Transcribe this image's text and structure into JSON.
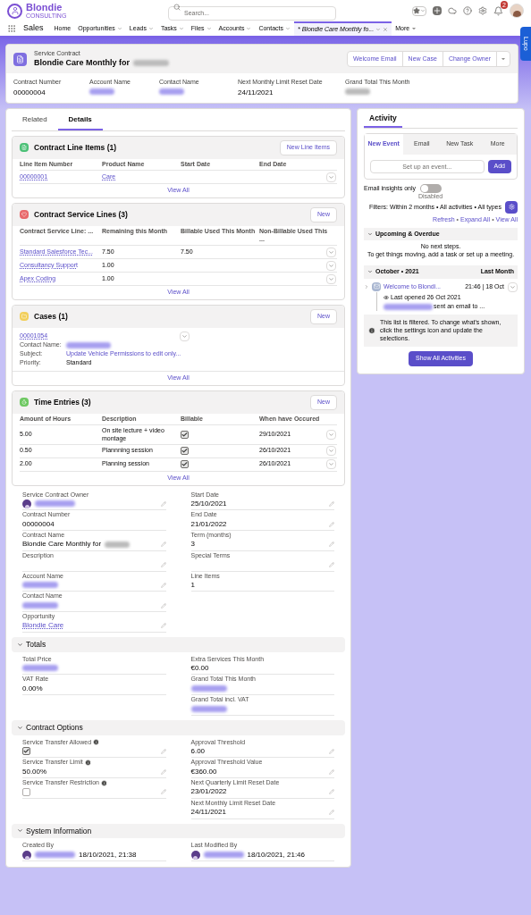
{
  "app": {
    "logo": "Blondie",
    "logo_sub": "CONSULTING",
    "search_placeholder": "Search...",
    "notification_count": "2",
    "name": "Sales"
  },
  "nav": [
    {
      "label": "Home",
      "dropdown": false,
      "selected": false
    },
    {
      "label": "Opportunities",
      "dropdown": true,
      "selected": false
    },
    {
      "label": "Leads",
      "dropdown": true,
      "selected": false
    },
    {
      "label": "Tasks",
      "dropdown": true,
      "selected": false
    },
    {
      "label": "Files",
      "dropdown": true,
      "selected": false
    },
    {
      "label": "Accounts",
      "dropdown": true,
      "selected": false
    },
    {
      "label": "Contacts",
      "dropdown": true,
      "selected": false
    },
    {
      "label": "* Blondie Care Monthly fo...",
      "dropdown": true,
      "selected": true
    }
  ],
  "nav_more": "More",
  "side_tab": "Lupo",
  "record": {
    "type": "Service Contract",
    "title": "Blondie Care Monthly for",
    "title_blurred": true,
    "actions": [
      "Welcome Email",
      "New Case",
      "Change Owner"
    ],
    "highlights": [
      {
        "label": "Contract Number",
        "value": "00000004",
        "blurred": false,
        "link": false
      },
      {
        "label": "Account Name",
        "blurred": true,
        "link": true
      },
      {
        "label": "Contact Name",
        "blurred": true,
        "link": true
      },
      {
        "label": "Next Monthly Limit Reset Date",
        "value": "24/11/2021",
        "blurred": false,
        "link": false
      },
      {
        "label": "Grand Total This Month",
        "blurred": true,
        "link": false
      }
    ]
  },
  "tabs": [
    {
      "label": "Related",
      "selected": false
    },
    {
      "label": "Details",
      "selected": true
    }
  ],
  "related_lists": [
    {
      "kind": "table",
      "title": "Contract Line Items (1)",
      "color": "#4bc076",
      "button": "New Line Items",
      "columns": [
        "Line Item Number",
        "Product Name",
        "Start Date",
        "End Date"
      ],
      "rows": [
        {
          "cells": [
            {
              "kind": "link",
              "text": "00000001"
            },
            {
              "kind": "link",
              "text": "Care"
            },
            {
              "kind": "text",
              "text": ""
            },
            {
              "kind": "text",
              "text": ""
            }
          ]
        }
      ],
      "view_all": "View All"
    },
    {
      "kind": "table",
      "title": "Contract Service Lines (3)",
      "color": "#e8696b",
      "button": "New",
      "columns": [
        "Contract Service Line: ...",
        "Remaining this Month",
        "Billable Used This Month",
        "Non-Billable Used This ..."
      ],
      "rows": [
        {
          "cells": [
            {
              "kind": "link",
              "text": "Standard Salesforce Tec..."
            },
            {
              "kind": "text",
              "text": "7.50"
            },
            {
              "kind": "text",
              "text": "7.50"
            },
            {
              "kind": "text",
              "text": ""
            }
          ]
        },
        {
          "cells": [
            {
              "kind": "link",
              "text": "Consultancy Support"
            },
            {
              "kind": "text",
              "text": "1.00"
            },
            {
              "kind": "text",
              "text": ""
            },
            {
              "kind": "text",
              "text": ""
            }
          ]
        },
        {
          "cells": [
            {
              "kind": "link",
              "text": "Apex Coding"
            },
            {
              "kind": "text",
              "text": "1.00"
            },
            {
              "kind": "text",
              "text": ""
            },
            {
              "kind": "text",
              "text": ""
            }
          ]
        }
      ],
      "view_all": "View All"
    },
    {
      "kind": "tiles",
      "title": "Cases (1)",
      "color": "#f2cf5b",
      "button": "New",
      "tiles": [
        {
          "number": "00001054",
          "fields": [
            {
              "label": "Contact Name:",
              "blurred": true
            },
            {
              "label": "Subject:",
              "value": "Update Vehicle Permissions to edit only...",
              "link": true,
              "blurred": false
            },
            {
              "label": "Priority:",
              "value": "Standard",
              "link": false,
              "blurred": false
            }
          ]
        }
      ],
      "view_all": "View All"
    },
    {
      "kind": "table",
      "title": "Time Entries (3)",
      "color": "#6ec862",
      "button": "New",
      "columns": [
        "Amount of Hours",
        "Description",
        "Billable",
        "When have Occured"
      ],
      "rows": [
        {
          "cells": [
            {
              "kind": "text",
              "text": "5.00"
            },
            {
              "kind": "text",
              "text": "On site lecture + video montage"
            },
            {
              "kind": "checkbox",
              "checked": true
            },
            {
              "kind": "text",
              "text": "29/10/2021"
            }
          ]
        },
        {
          "cells": [
            {
              "kind": "text",
              "text": "0.50"
            },
            {
              "kind": "text",
              "text": "Plannning session"
            },
            {
              "kind": "checkbox",
              "checked": true
            },
            {
              "kind": "text",
              "text": "26/10/2021"
            }
          ]
        },
        {
          "cells": [
            {
              "kind": "text",
              "text": "2.00"
            },
            {
              "kind": "text",
              "text": "Planning session"
            },
            {
              "kind": "checkbox",
              "checked": true
            },
            {
              "kind": "text",
              "text": "26/10/2021"
            }
          ]
        }
      ],
      "view_all": "View All"
    }
  ],
  "detail_sections": [
    {
      "left": [
        {
          "label": "Service Contract Owner",
          "kind": "user",
          "editable": true
        },
        {
          "label": "Contract Number",
          "kind": "text",
          "value": "00000004",
          "editable": false
        },
        {
          "label": "Contract Name",
          "kind": "text",
          "value": "Blondie Care Monthly for",
          "blurred_tail": true,
          "editable": true
        },
        {
          "label": "Description",
          "kind": "empty",
          "editable": true
        },
        {
          "label": "Account Name",
          "kind": "blurred",
          "editable": true
        },
        {
          "label": "Contact Name",
          "kind": "blurred",
          "editable": true
        },
        {
          "label": "Opportunity",
          "kind": "link",
          "value": "Blondie Care",
          "editable": true
        }
      ],
      "right": [
        {
          "label": "Start Date",
          "kind": "text",
          "value": "25/10/2021",
          "editable": true
        },
        {
          "label": "End Date",
          "kind": "text",
          "value": "21/01/2022",
          "editable": true
        },
        {
          "label": "Term (months)",
          "kind": "text",
          "value": "3",
          "editable": true
        },
        {
          "label": "Special Terms",
          "kind": "empty",
          "editable": true
        },
        {
          "label": "Line Items",
          "kind": "text",
          "value": "1",
          "editable": false
        }
      ]
    },
    {
      "title": "Totals",
      "expanded": true,
      "left": [
        {
          "label": "Total Price",
          "kind": "blurred",
          "editable": false
        },
        {
          "label": "VAT Rate",
          "kind": "text",
          "value": "0.00%",
          "editable": false
        }
      ],
      "right": [
        {
          "label": "Extra Services This Month",
          "kind": "text",
          "value": "€0.00",
          "editable": false
        },
        {
          "label": "Grand Total This Month",
          "kind": "blurred",
          "editable": false
        },
        {
          "label": "Grand Total incl. VAT",
          "kind": "blurred",
          "editable": false
        }
      ]
    },
    {
      "title": "Contract Options",
      "expanded": true,
      "left": [
        {
          "label": "Service Transfer Allowed",
          "kind": "checkbox",
          "checked": true,
          "info": true,
          "editable": true
        },
        {
          "label": "Service Transfer Limit",
          "kind": "text",
          "value": "50.00%",
          "info": true,
          "editable": true
        },
        {
          "label": "Service Transfer Restriction",
          "kind": "checkbox",
          "checked": false,
          "info": true,
          "editable": true
        }
      ],
      "right": [
        {
          "label": "Approval Threshold",
          "kind": "text",
          "value": "6.00",
          "editable": true
        },
        {
          "label": "Approval Threshold Value",
          "kind": "text",
          "value": "€360.00",
          "editable": true
        },
        {
          "label": "Next Quarterly Limit Reset Date",
          "kind": "text",
          "value": "23/01/2022",
          "editable": true
        },
        {
          "label": "Next Monthly Limit Reset Date",
          "kind": "text",
          "value": "24/11/2021",
          "editable": true
        }
      ]
    },
    {
      "title": "System Information",
      "expanded": true,
      "left": [
        {
          "label": "Created By",
          "kind": "user",
          "value": "18/10/2021, 21:38",
          "editable": false
        }
      ],
      "right": [
        {
          "label": "Last Modified By",
          "kind": "user",
          "value": "18/10/2021, 21:46",
          "editable": false
        }
      ]
    }
  ],
  "activity": {
    "tab": "Activity",
    "composer_tabs": [
      {
        "label": "New Event",
        "selected": true
      },
      {
        "label": "Email",
        "selected": false
      },
      {
        "label": "New Task",
        "selected": false
      },
      {
        "label": "More",
        "selected": false
      }
    ],
    "placeholder": "Set up an event...",
    "add": "Add",
    "toggle": {
      "label": "Email insights only",
      "on": false,
      "state_label": "Disabled"
    },
    "filters": "Filters: Within 2 months • All activities • All types",
    "links": [
      "Refresh",
      "Expand All",
      "View All"
    ],
    "link_separator": "•",
    "groups": [
      {
        "title": "Upcoming & Overdue",
        "expanded": true,
        "lines": [
          "No next steps.",
          "To get things moving, add a task or set up a meeting."
        ]
      },
      {
        "title": "October • 2021",
        "aside": "Last Month",
        "expanded": true,
        "items": [
          {
            "title": "Welcome to Blondi...",
            "time": "21:46 | 18 Oct",
            "opened": "Last opened 26 Oct 2021",
            "summary": "sent an email to ..."
          }
        ]
      }
    ],
    "note": "This list is filtered. To change what's shown, click the settings icon and update the selections.",
    "show_all": "Show All Activities"
  }
}
